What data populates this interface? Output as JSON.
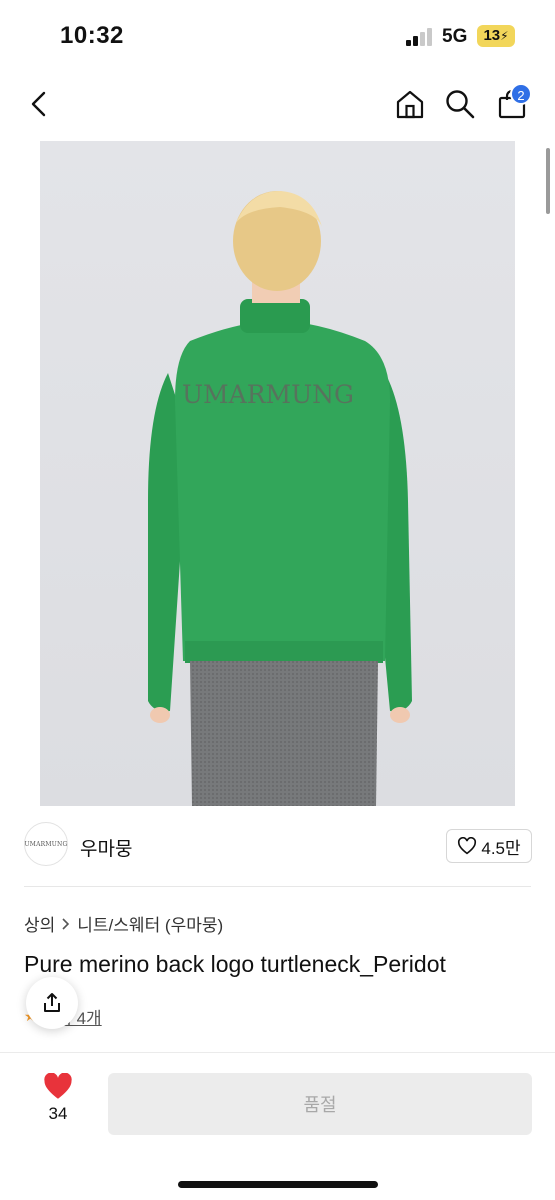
{
  "status_bar": {
    "time": "10:32",
    "network": "5G",
    "battery": "13"
  },
  "header": {
    "cart_badge": "2",
    "icons": [
      "chevron-left-icon",
      "home-icon",
      "search-icon",
      "bag-icon"
    ]
  },
  "product_image": {
    "print_text": "UMARMUNG"
  },
  "brand": {
    "logo_text": "UMARMUNG",
    "name": "우마뭉",
    "likes": "4.5만"
  },
  "breadcrumb": {
    "category": "상의",
    "subcategory": "니트/스웨터 (우마뭉)"
  },
  "product": {
    "title": "Pure merino back logo turtleneck_Peridot",
    "review_text": "후기 4개",
    "review_visible_text": "기 4개"
  },
  "bottom_bar": {
    "wish_count": "34",
    "purchase_label": "품절"
  },
  "colors": {
    "badge": "#2f6fe6",
    "heart": "#e8333b",
    "sweater": "#2fa257",
    "disabled_button": "#ececec"
  }
}
